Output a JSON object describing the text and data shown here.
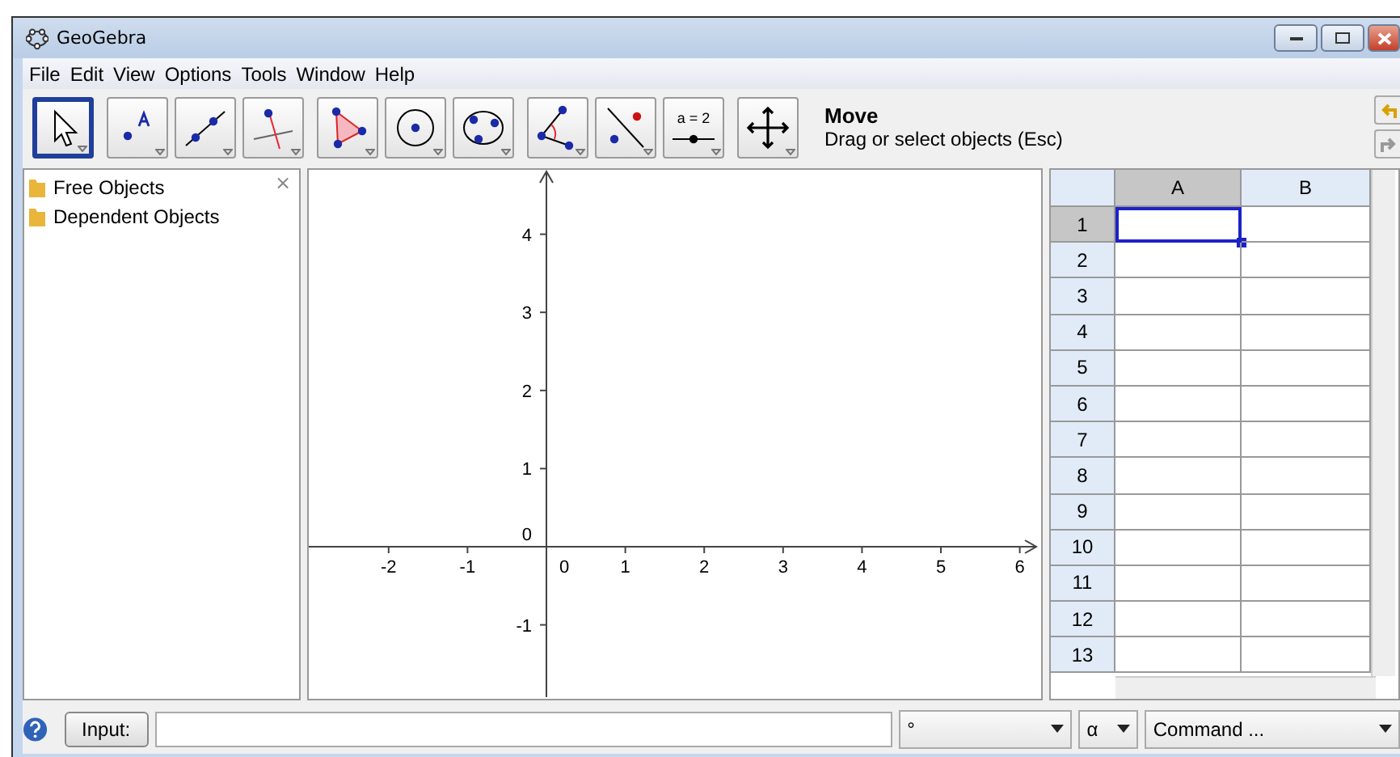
{
  "window": {
    "title": "GeoGebra"
  },
  "menu": [
    "File",
    "Edit",
    "View",
    "Options",
    "Tools",
    "Window",
    "Help"
  ],
  "tool_groups": [
    [
      {
        "kind": "move",
        "selected": true
      }
    ],
    [
      {
        "kind": "point",
        "selected": false
      },
      {
        "kind": "line",
        "selected": false
      },
      {
        "kind": "perpendicular",
        "selected": false
      }
    ],
    [
      {
        "kind": "polygon",
        "selected": false
      },
      {
        "kind": "circle",
        "selected": false
      },
      {
        "kind": "conic",
        "selected": false
      }
    ],
    [
      {
        "kind": "angle",
        "selected": false
      },
      {
        "kind": "reflect",
        "selected": false
      },
      {
        "kind": "slider",
        "selected": false,
        "label": "a = 2"
      }
    ],
    [
      {
        "kind": "pan",
        "selected": false
      }
    ]
  ],
  "tool_info": {
    "name": "Move",
    "description": "Drag or select objects (Esc)"
  },
  "algebra": {
    "close": "×",
    "items": [
      {
        "label": "Free Objects"
      },
      {
        "label": "Dependent Objects"
      }
    ]
  },
  "graphics": {
    "x_ticks": [
      "-2",
      "-1",
      "0",
      "1",
      "2",
      "3",
      "4",
      "5",
      "6"
    ],
    "y_ticks": [
      "4",
      "3",
      "2",
      "1",
      "-1"
    ],
    "origin": "0"
  },
  "spreadsheet": {
    "columns": [
      {
        "label": "A",
        "selected": true
      },
      {
        "label": "B",
        "selected": false
      }
    ],
    "rows": [
      {
        "label": "1",
        "selected": true
      },
      {
        "label": "2",
        "selected": false
      },
      {
        "label": "3",
        "selected": false
      },
      {
        "label": "4",
        "selected": false
      },
      {
        "label": "5",
        "selected": false
      },
      {
        "label": "6",
        "selected": false
      },
      {
        "label": "7",
        "selected": false
      },
      {
        "label": "8",
        "selected": false
      },
      {
        "label": "9",
        "selected": false
      },
      {
        "label": "10",
        "selected": false
      },
      {
        "label": "11",
        "selected": false
      },
      {
        "label": "12",
        "selected": false
      },
      {
        "label": "13",
        "selected": false
      }
    ]
  },
  "input_bar": {
    "button": "Input:",
    "degree": "°",
    "alpha": "α",
    "command": "Command ..."
  }
}
